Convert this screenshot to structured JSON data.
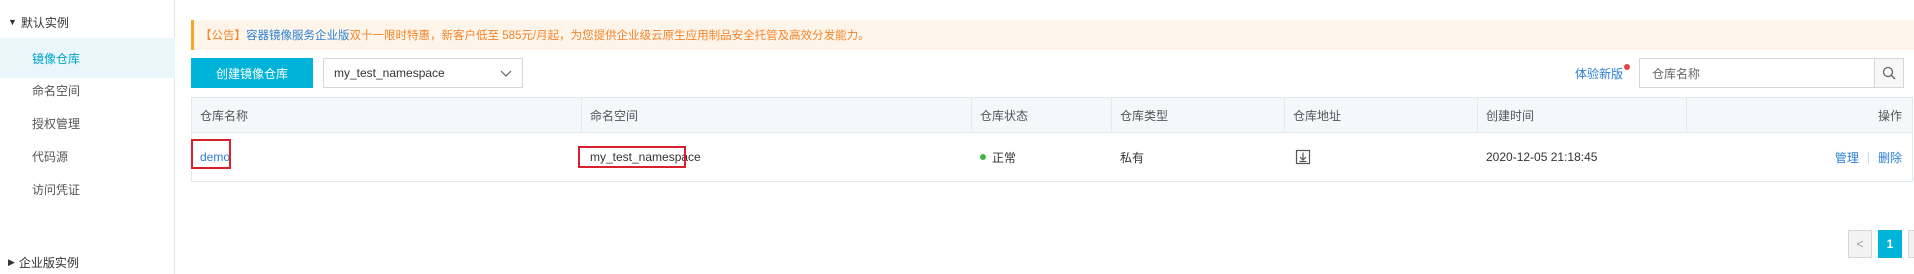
{
  "sidebar": {
    "group_default": "默认实例",
    "items": [
      {
        "label": "镜像仓库",
        "active": true
      },
      {
        "label": "命名空间",
        "active": false
      },
      {
        "label": "授权管理",
        "active": false
      },
      {
        "label": "代码源",
        "active": false
      },
      {
        "label": "访问凭证",
        "active": false
      }
    ],
    "group_enterprise": "企业版实例"
  },
  "notice": {
    "prefix": "【公告】",
    "link": "容器镜像服务企业版",
    "promo": "双十一限时特惠",
    "text": "，新客户低至 585元/月起，为您提供企业级云原生应用制品安全托管及高效分发能力。"
  },
  "toolbar": {
    "create_label": "创建镜像仓库",
    "namespace_value": "my_test_namespace",
    "new_version_label": "体验新版",
    "search_placeholder": "仓库名称"
  },
  "table": {
    "headers": [
      "仓库名称",
      "命名空间",
      "仓库状态",
      "仓库类型",
      "仓库地址",
      "创建时间",
      "操作"
    ],
    "rows": [
      {
        "name": "demo",
        "namespace": "my_test_namespace",
        "status": "正常",
        "type": "私有",
        "created": "2020-12-05 21:18:45",
        "op_manage": "管理",
        "op_sep": "|",
        "op_delete": "删除"
      }
    ]
  },
  "pagination": {
    "prev": "<",
    "current": "1",
    "next": ">"
  },
  "colors": {
    "accent": "#00b3d9",
    "link": "#2c7fd5",
    "notice_text": "#f5842a",
    "status_ok": "#44b549",
    "highlight": "#d9202d"
  }
}
